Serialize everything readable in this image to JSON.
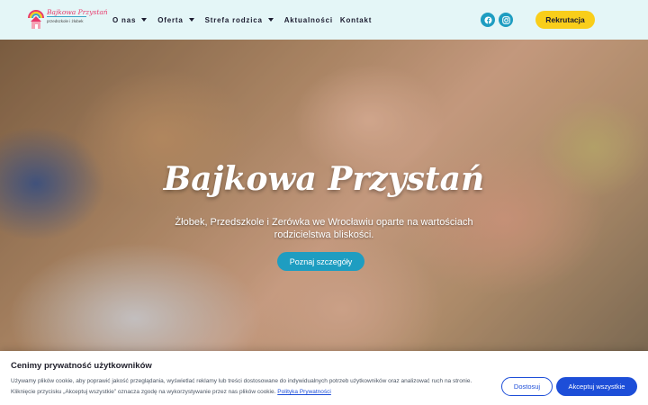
{
  "header": {
    "logo": {
      "title": "Bajkowa Przystań",
      "subtitle": "przedszkole i żłobek",
      "icon": "house-rainbow-logo-icon"
    },
    "nav": [
      {
        "label": "O nas",
        "has_dropdown": true
      },
      {
        "label": "Oferta",
        "has_dropdown": true
      },
      {
        "label": "Strefa rodzica",
        "has_dropdown": true
      },
      {
        "label": "Aktualności",
        "has_dropdown": false
      },
      {
        "label": "Kontakt",
        "has_dropdown": false
      }
    ],
    "social": {
      "facebook_icon": "facebook-icon",
      "instagram_icon": "instagram-icon",
      "color": "#1e9dc1"
    },
    "cta_label": "Rekrutacja",
    "cta_color": "#f9ce1a"
  },
  "hero": {
    "title": "Bajkowa Przystań",
    "text": "Żłobek, Przedszkole i Zerówka we Wrocławiu oparte na wartościach rodzicielstwa bliskości.",
    "button_label": "Poznaj szczegóły",
    "button_color": "#1e9dc1"
  },
  "cookie": {
    "title": "Cenimy prywatność użytkowników",
    "text": "Używamy plików cookie, aby poprawić jakość przeglądania, wyświetlać reklamy lub treści dostosowane do indywidualnych potrzeb użytkowników oraz analizować ruch na stronie. Kliknięcie przycisku „Akceptuj wszystkie” oznacza zgodę na wykorzystywanie przez nas plików cookie.",
    "link_label": "Polityka Prywatności",
    "settings_label": "Dostosuj",
    "accept_label": "Akceptuj wszystkie",
    "accent_color": "#1d4ed8"
  }
}
